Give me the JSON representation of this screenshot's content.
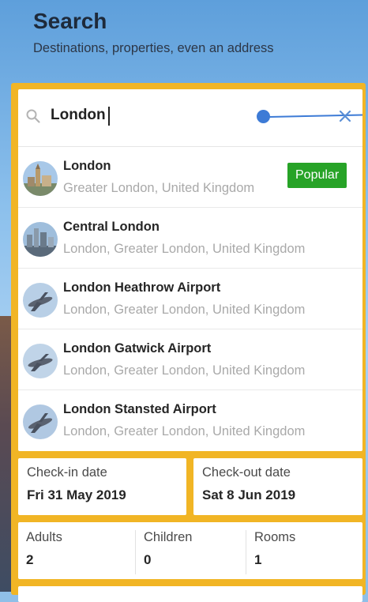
{
  "header": {
    "title": "Search",
    "subtitle": "Destinations, properties, even an address"
  },
  "search": {
    "value": "London"
  },
  "results": [
    {
      "title": "London",
      "subtitle": "Greater London, United Kingdom",
      "badge": "Popular",
      "thumb": "city-thumbnail"
    },
    {
      "title": "Central London",
      "subtitle": "London, Greater London, United Kingdom",
      "thumb": "city-thumbnail"
    },
    {
      "title": "London Heathrow Airport",
      "subtitle": "London, Greater London, United Kingdom",
      "thumb": "airplane-thumbnail"
    },
    {
      "title": "London Gatwick Airport",
      "subtitle": "London, Greater London, United Kingdom",
      "thumb": "airplane-thumbnail"
    },
    {
      "title": "London Stansted Airport",
      "subtitle": "London, Greater London, United Kingdom",
      "thumb": "airplane-thumbnail"
    }
  ],
  "dates": {
    "checkin_label": "Check-in date",
    "checkin_value": "Fri 31 May 2019",
    "checkout_label": "Check-out date",
    "checkout_value": "Sat 8 Jun 2019"
  },
  "occupancy": {
    "adults_label": "Adults",
    "adults_value": "2",
    "children_label": "Children",
    "children_value": "0",
    "rooms_label": "Rooms",
    "rooms_value": "1"
  },
  "colors": {
    "panel": "#f1b525",
    "badge": "#27a327",
    "pointer": "#3d7bd6"
  }
}
